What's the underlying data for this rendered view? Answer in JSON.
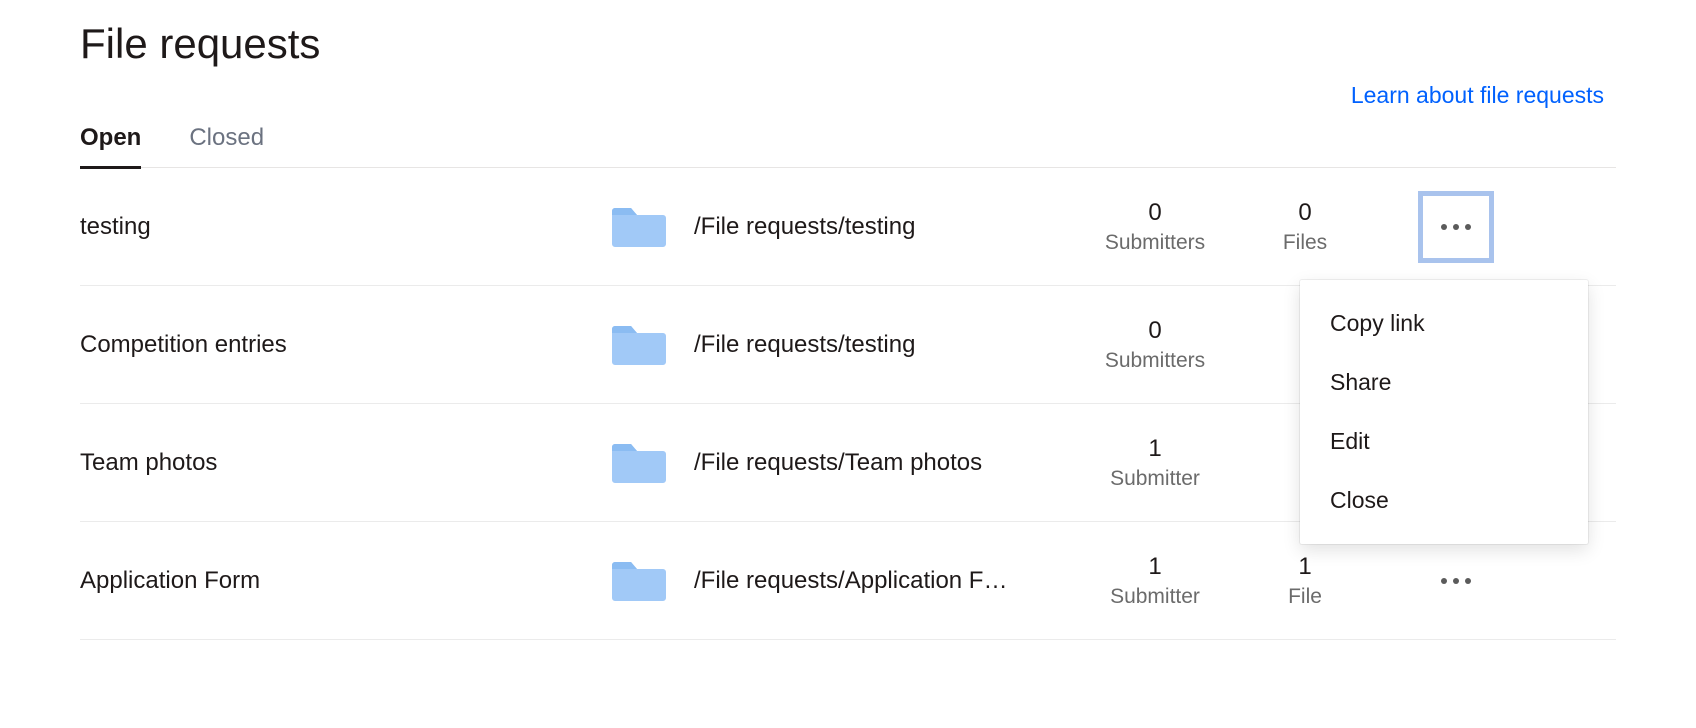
{
  "title": "File requests",
  "learn_link": "Learn about file requests",
  "tabs": {
    "open": "Open",
    "closed": "Closed"
  },
  "rows": [
    {
      "name": "testing",
      "path": "/File requests/testing",
      "submitters_count": "0",
      "submitters_label": "Submitters",
      "files_count": "0",
      "files_label": "Files",
      "more_selected": true
    },
    {
      "name": "Competition entries",
      "path": "/File requests/testing",
      "submitters_count": "0",
      "submitters_label": "Submitters",
      "files_count": "",
      "files_label": "",
      "more_selected": false
    },
    {
      "name": "Team photos",
      "path": "/File requests/Team photos",
      "submitters_count": "1",
      "submitters_label": "Submitter",
      "files_count": "",
      "files_label": "",
      "more_selected": false
    },
    {
      "name": "Application Form",
      "path": "/File requests/Application F…",
      "submitters_count": "1",
      "submitters_label": "Submitter",
      "files_count": "1",
      "files_label": "File",
      "more_selected": false
    }
  ],
  "menu": {
    "copy_link": "Copy link",
    "share": "Share",
    "edit": "Edit",
    "close": "Close"
  }
}
